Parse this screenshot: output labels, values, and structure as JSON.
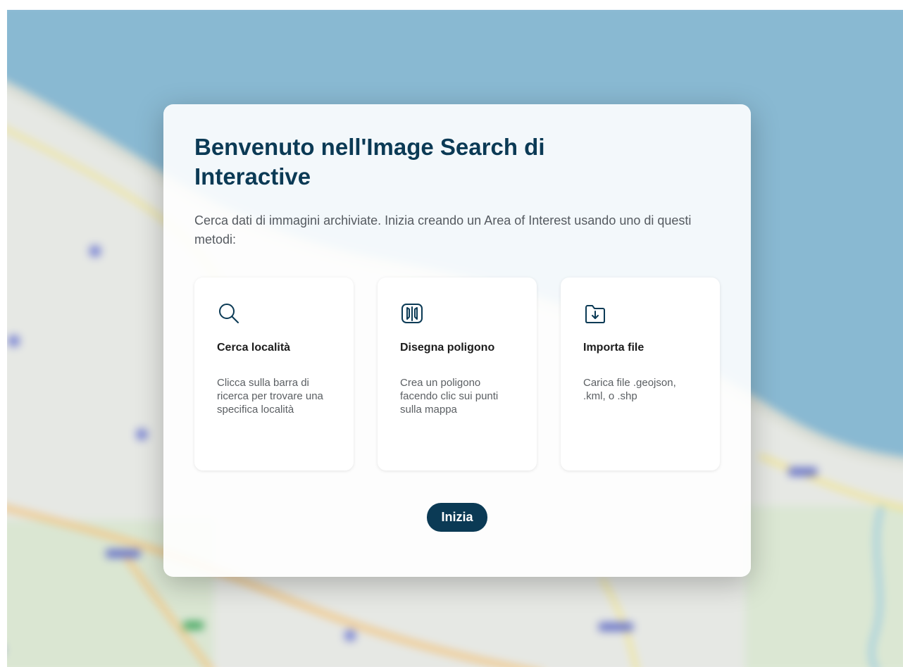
{
  "modal": {
    "title": "Benvenuto nell'Image Search di Interactive",
    "description": "Cerca dati di immagini archiviate. Inizia creando un Area of Interest usando uno di questi metodi:",
    "start_label": "Inizia"
  },
  "methods": [
    {
      "icon": "search-icon",
      "title": "Cerca località",
      "text": "Clicca sulla barra di ricerca per trovare una specifica località"
    },
    {
      "icon": "map-icon",
      "title": "Disegna poligono",
      "text": "Crea un poligono facendo clic sui punti sulla mappa"
    },
    {
      "icon": "folder-import-icon",
      "title": "Importa file",
      "text": "Carica file .geojson, .kml, o .shp"
    }
  ],
  "colors": {
    "accent": "#0b3a55",
    "sea": "#7fb3cf",
    "land": "#e6e8e4",
    "road_major": "#f2c27a",
    "road_secondary": "#f4e27e"
  }
}
